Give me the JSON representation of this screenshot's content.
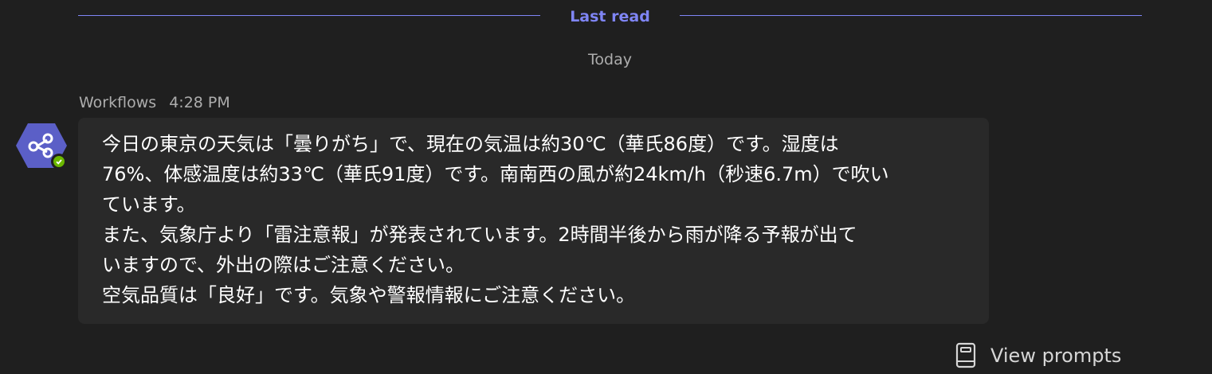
{
  "divider": {
    "label": "Last read"
  },
  "date_separator": "Today",
  "message": {
    "sender": "Workflows",
    "time": "4:28 PM",
    "lines": [
      "今日の東京の天気は「曇りがち」で、現在の気温は約30℃（華氏86度）です。湿度は",
      "76%、体感温度は約33℃（華氏91度）です。南南西の風が約24km/h（秒速6.7m）で吹い",
      "ています。",
      "また、気象庁より「雷注意報」が発表されています。2時間半後から雨が降る予報が出て",
      "いますので、外出の際はご注意ください。",
      "空気品質は「良好」です。気象や警報情報にご注意ください。"
    ]
  },
  "avatar": {
    "icon": "share-nodes-icon",
    "color": "#5b5fc7",
    "status": "available",
    "status_color": "#6bb700"
  },
  "actions": {
    "view_prompts_label": "View prompts",
    "view_prompts_icon": "prompt-book-icon"
  },
  "colors": {
    "background": "#1f1f1f",
    "bubble": "#292929",
    "accent": "#7f85f5",
    "muted_text": "#adadad"
  }
}
